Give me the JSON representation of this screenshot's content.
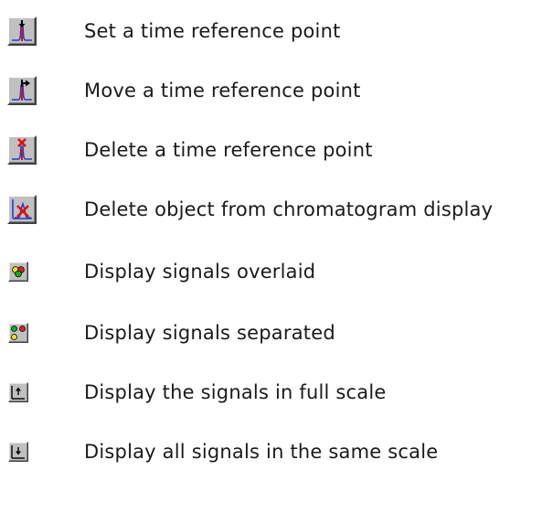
{
  "items": [
    {
      "label": "Set a time reference point",
      "icon": "set-time-reference-icon"
    },
    {
      "label": "Move a time reference point",
      "icon": "move-time-reference-icon"
    },
    {
      "label": "Delete a time reference point",
      "icon": "delete-time-reference-icon"
    },
    {
      "label": "Delete object from chromatogram display",
      "icon": "delete-object-icon"
    },
    {
      "label": "Display signals overlaid",
      "icon": "signals-overlaid-icon"
    },
    {
      "label": "Display signals separated",
      "icon": "signals-separated-icon"
    },
    {
      "label": "Display the signals in full scale",
      "icon": "full-scale-icon"
    },
    {
      "label": "Display all signals in the same scale",
      "icon": "same-scale-icon"
    }
  ],
  "colors": {
    "button_face": "#c0c0c0",
    "peak_blue": "#1f3fd0",
    "marker_red": "#e01010",
    "marker_black": "#000000",
    "signal_yellow": "#f0e020",
    "signal_green": "#10b020",
    "signal_red": "#e02020"
  }
}
